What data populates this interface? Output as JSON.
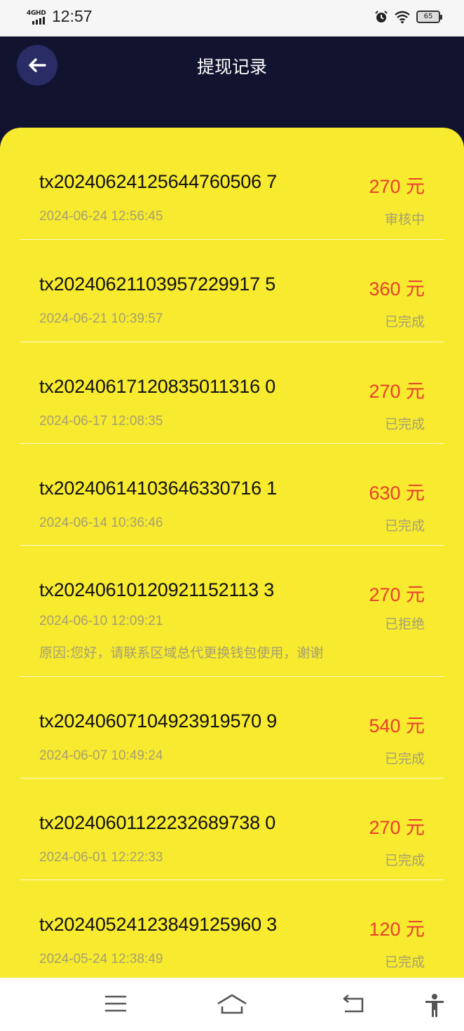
{
  "status_bar": {
    "network": "4GHD",
    "time": "12:57",
    "battery": "65"
  },
  "header": {
    "title": "提现记录"
  },
  "records": [
    {
      "id": "tx20240624125644760506 7",
      "amount": "270 元",
      "time": "2024-06-24 12:56:45",
      "status": "审核中"
    },
    {
      "id": "tx20240621103957229917 5",
      "amount": "360 元",
      "time": "2024-06-21 10:39:57",
      "status": "已完成"
    },
    {
      "id": "tx20240617120835011316 0",
      "amount": "270 元",
      "time": "2024-06-17 12:08:35",
      "status": "已完成"
    },
    {
      "id": "tx20240614103646330716 1",
      "amount": "630 元",
      "time": "2024-06-14 10:36:46",
      "status": "已完成"
    },
    {
      "id": "tx20240610120921152113 3",
      "amount": "270 元",
      "time": "2024-06-10 12:09:21",
      "status": "已拒绝",
      "reason": "原因:您好，请联系区域总代更换钱包使用，谢谢"
    },
    {
      "id": "tx20240607104923919570 9",
      "amount": "540 元",
      "time": "2024-06-07 10:49:24",
      "status": "已完成"
    },
    {
      "id": "tx20240601122232689738 0",
      "amount": "270 元",
      "time": "2024-06-01 12:22:33",
      "status": "已完成"
    },
    {
      "id": "tx20240524123849125960 3",
      "amount": "120 元",
      "time": "2024-05-24 12:38:49",
      "status": "已完成"
    }
  ],
  "icons": {
    "back": "arrow-left-icon",
    "menu": "menu-icon",
    "home": "home-icon",
    "return": "return-icon",
    "accessibility": "accessibility-icon"
  }
}
